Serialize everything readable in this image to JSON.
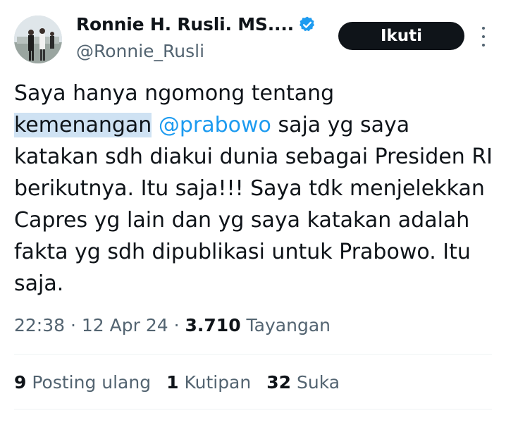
{
  "author": {
    "display_name": "Ronnie H. Rusli. MS....",
    "handle": "@Ronnie_Rusli",
    "verified_icon": "verified-badge-icon",
    "avatar_icon": "profile-photo"
  },
  "actions": {
    "follow_label": "Ikuti",
    "more_icon": "more-vertical-icon"
  },
  "tweet": {
    "line1": "Saya hanya ngomong tentang",
    "highlight": "kemenangan",
    "mention": "@prabowo",
    "rest": " saja yg saya katakan sdh diakui dunia sebagai Presiden RI berikutnya. Itu saja!!! Saya tdk menjelekkan Capres yg lain dan yg saya katakan adalah fakta yg sdh dipublikasi untuk Prabowo. Itu saja."
  },
  "meta": {
    "time": "22:38",
    "sep1": " · ",
    "date": "12 Apr 24",
    "sep2": " · ",
    "views_count": "3.710",
    "views_label": " Tayangan"
  },
  "stats": {
    "reposts_count": "9",
    "reposts_label": " Posting ulang",
    "quotes_count": "1",
    "quotes_label": " Kutipan",
    "likes_count": "32",
    "likes_label": " Suka"
  },
  "colors": {
    "accent": "#1d9bf0",
    "text": "#0f1419",
    "secondary": "#536471",
    "highlight": "#cfe2f3",
    "button_bg": "#0f1419"
  }
}
